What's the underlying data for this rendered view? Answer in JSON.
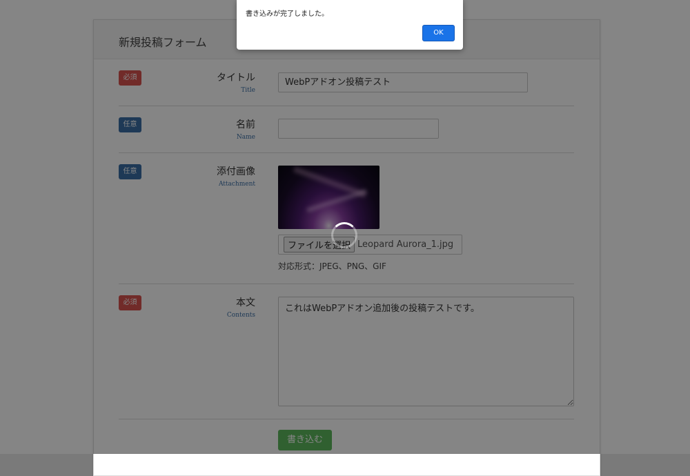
{
  "form": {
    "title": "新規投稿フォーム",
    "fields": {
      "title": {
        "badge": "必須",
        "label": "タイトル",
        "label_en": "Title",
        "value": "WebPアドオン投稿テスト"
      },
      "name": {
        "badge": "任意",
        "label": "名前",
        "label_en": "Name",
        "value": ""
      },
      "attachment": {
        "badge": "任意",
        "label": "添付画像",
        "label_en": "Attachment",
        "file_button": "ファイルを選択",
        "file_name": "Leopard Aurora_1.jpg",
        "formats": "対応形式：JPEG、PNG、GIF"
      },
      "contents": {
        "badge": "必須",
        "label": "本文",
        "label_en": "Contents",
        "value": "これはWebPアドオン追加後の投稿テストです。"
      }
    },
    "submit_label": "書き込む"
  },
  "dialog": {
    "message": "書き込みが完了しました。",
    "ok_label": "OK"
  },
  "colors": {
    "required_badge": "#d9534f",
    "optional_badge": "#3a6ea5",
    "submit": "#5cb85c",
    "dialog_ok": "#1a73e8"
  },
  "icons": {
    "loading": "spinner-icon"
  }
}
